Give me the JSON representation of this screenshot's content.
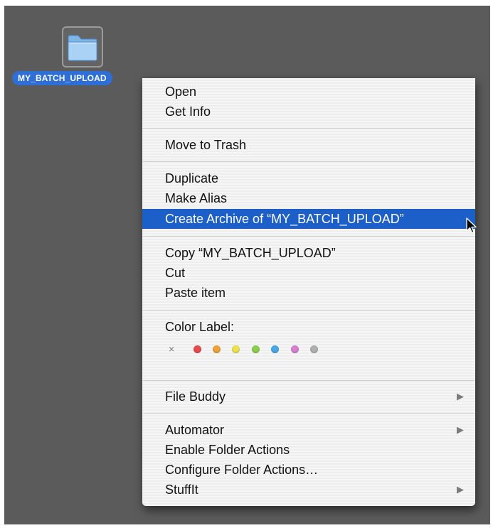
{
  "folder": {
    "name": "MY_BATCH_UPLOAD",
    "icon": "folder-icon"
  },
  "menu": {
    "open": "Open",
    "get_info": "Get Info",
    "move_to_trash": "Move to Trash",
    "duplicate": "Duplicate",
    "make_alias": "Make Alias",
    "create_archive": "Create Archive of “MY_BATCH_UPLOAD”",
    "copy": "Copy “MY_BATCH_UPLOAD”",
    "cut": "Cut",
    "paste": "Paste item",
    "color_label": "Color Label:",
    "file_buddy": "File Buddy",
    "automator": "Automator",
    "enable_folder_actions": "Enable Folder Actions",
    "configure_folder_actions": "Configure Folder Actions…",
    "stuffit": "StuffIt",
    "highlighted_item": "create_archive",
    "submenu_arrow": "▶"
  },
  "color_labels": {
    "none_symbol": "×",
    "colors": [
      "#e84b4b",
      "#f0a23a",
      "#ece24b",
      "#8ccf4e",
      "#4aa8e8",
      "#d77fd1",
      "#b0b0b0"
    ]
  },
  "theme": {
    "highlight": "#1d5fc9",
    "folder_label_bg": "#2d6fd6",
    "desktop_bg": "#5b5b5b"
  }
}
